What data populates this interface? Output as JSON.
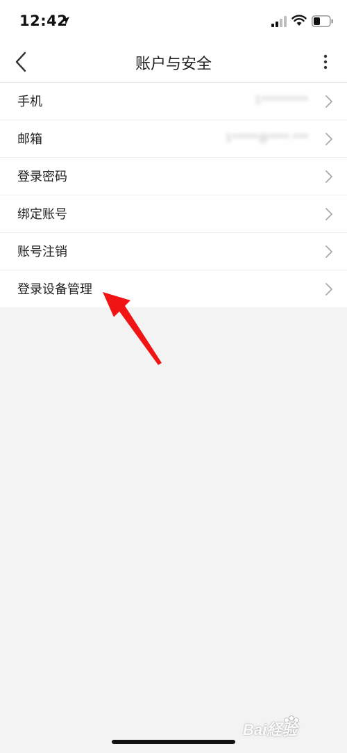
{
  "status_bar": {
    "time": "12:42"
  },
  "nav": {
    "title": "账户与安全",
    "back_icon": "chevron-left-icon",
    "more_icon": "vertical-dots-icon"
  },
  "list": {
    "items": [
      {
        "label": "手机",
        "value": "1*********"
      },
      {
        "label": "邮箱",
        "value": "1*****@****.***"
      },
      {
        "label": "登录密码",
        "value": ""
      },
      {
        "label": "绑定账号",
        "value": ""
      },
      {
        "label": "账号注销",
        "value": ""
      },
      {
        "label": "登录设备管理",
        "value": ""
      }
    ]
  },
  "annotation": {
    "color": "#f01414"
  },
  "watermark": {
    "text": "Bai経验"
  },
  "colors": {
    "background": "#f3f3f3",
    "surface": "#ffffff",
    "divider": "#efefef",
    "chevron": "#a8a8a8"
  }
}
